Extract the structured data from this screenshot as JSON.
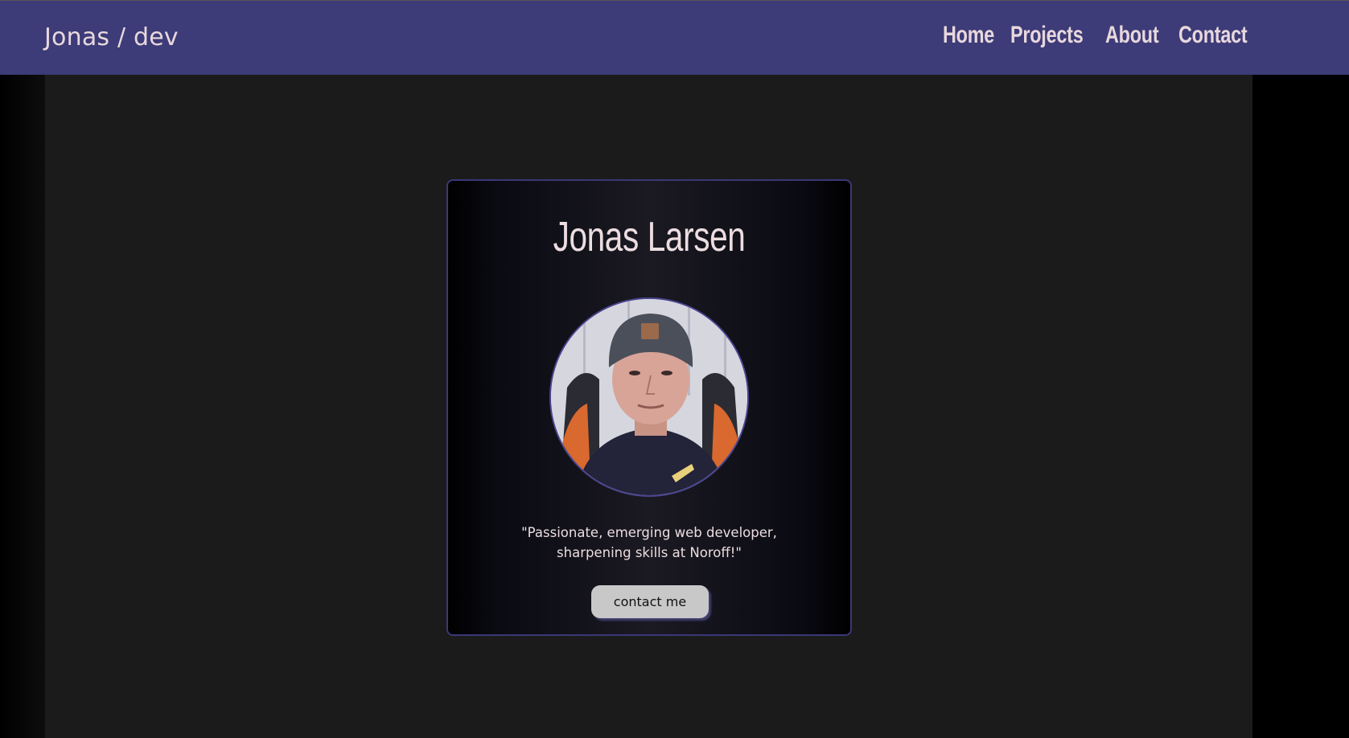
{
  "header": {
    "brand": "Jonas / dev",
    "nav": [
      {
        "label": "Home"
      },
      {
        "label": "Projects"
      },
      {
        "label": "About"
      },
      {
        "label": "Contact"
      }
    ]
  },
  "profile": {
    "name": "Jonas Larsen",
    "avatar_alt": "profile-photo",
    "quote_line1": "\"Passionate, emerging web developer,",
    "quote_line2": "sharpening skills at Noroff!\"",
    "button_label": "contact me"
  },
  "colors": {
    "header_bg": "#3d3b78",
    "text_light": "#ecdde0",
    "card_border": "#3a3878",
    "button_bg": "#c8c8c8",
    "page_bg": "#1b1b1b"
  }
}
